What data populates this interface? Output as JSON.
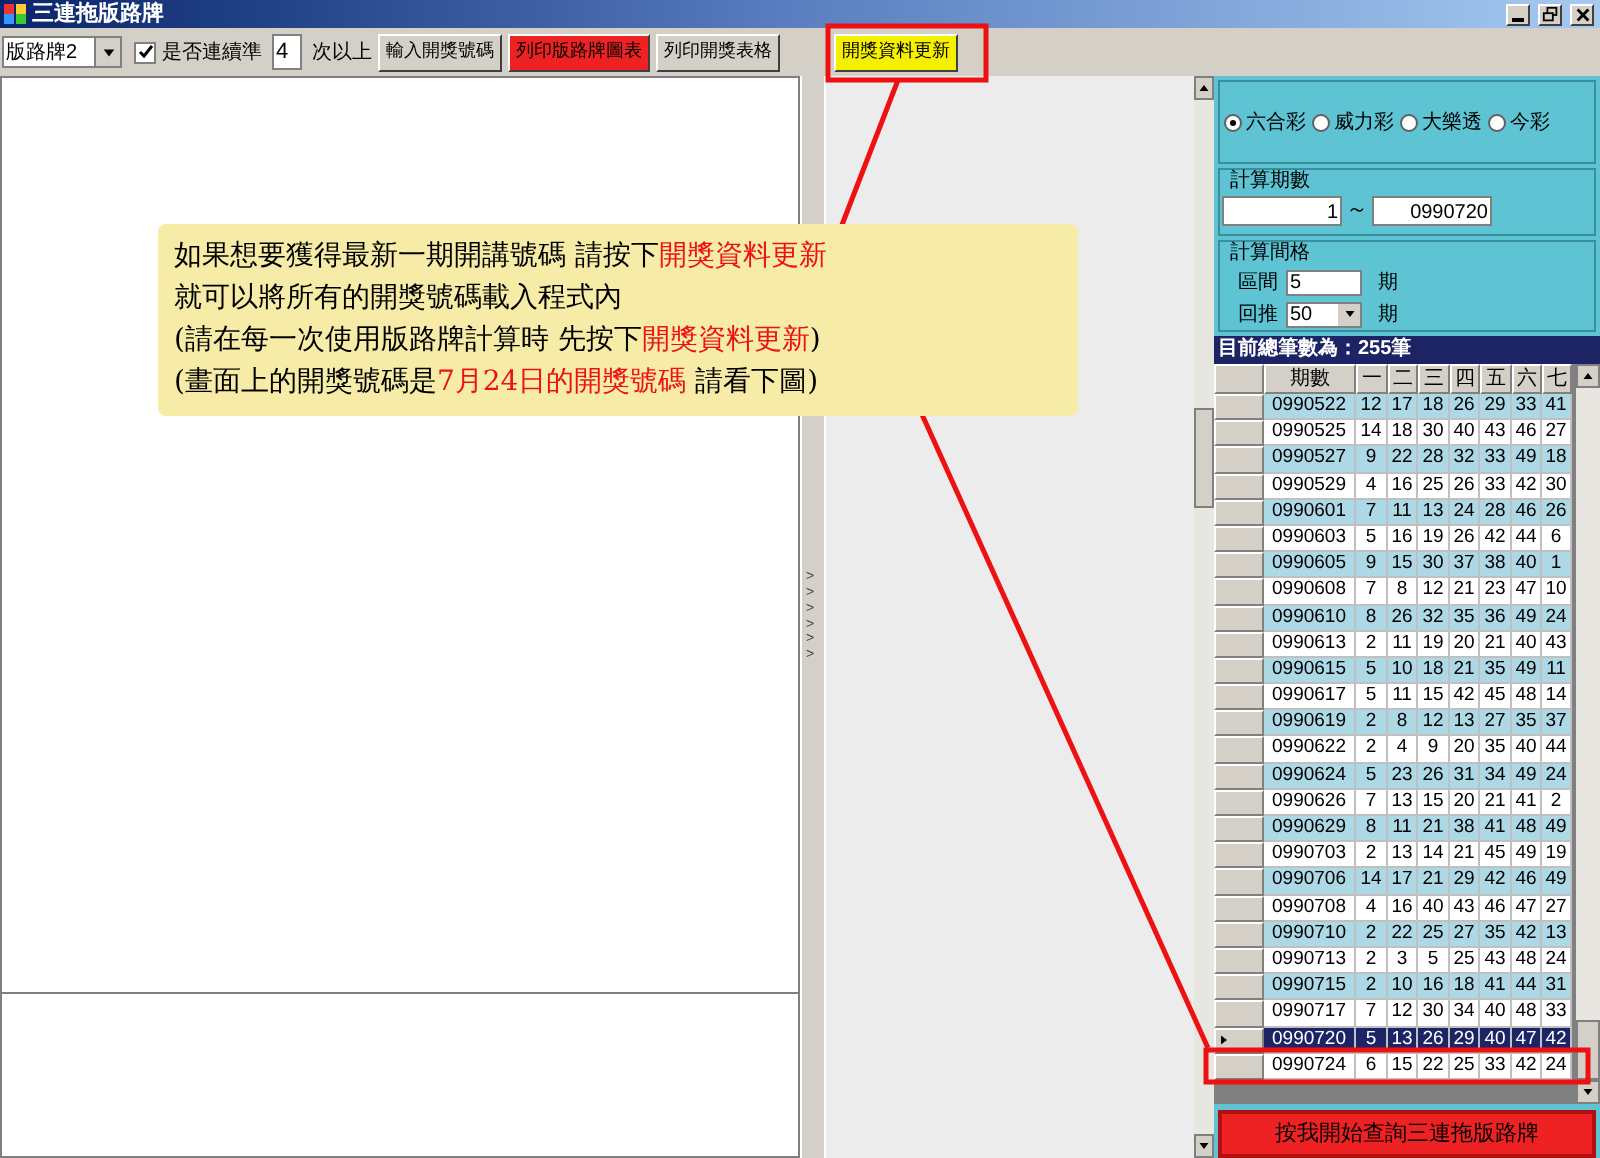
{
  "window": {
    "title": "三連拖版路牌"
  },
  "toolbar": {
    "dropdown": {
      "value": "版路牌2"
    },
    "checkbox": {
      "label": "是否連續準",
      "checked": true
    },
    "times_field": {
      "value": "4"
    },
    "times_suffix": "次以上",
    "buttons": [
      {
        "label": "輸入開獎號碼",
        "color": "#d4d0c8"
      },
      {
        "label": "列印版路牌圖表",
        "color": "#ee2222"
      },
      {
        "label": "列印開獎表格",
        "color": "#d4d0c8"
      },
      {
        "label": "開獎資料更新",
        "color": "#f4f000"
      }
    ]
  },
  "splitter": {
    "marks": ">>>>>>"
  },
  "lottery": {
    "radios": [
      {
        "label": "六合彩",
        "selected": true
      },
      {
        "label": "威力彩",
        "selected": false
      },
      {
        "label": "大樂透",
        "selected": false
      },
      {
        "label": "今彩",
        "selected": false
      }
    ],
    "period_range": {
      "title": "計算期數",
      "from": "1",
      "separator": "～",
      "to": "0990720"
    },
    "interval": {
      "title": "計算間格",
      "rows": [
        {
          "label": "區間",
          "value": "5",
          "unit": "期",
          "kind": "field"
        },
        {
          "label": "回推",
          "value": "50",
          "unit": "期",
          "kind": "dropdown"
        }
      ]
    }
  },
  "grid": {
    "caption": "目前總筆數為：255筆",
    "columns": [
      "期數",
      "一",
      "二",
      "三",
      "四",
      "五",
      "六",
      "七"
    ],
    "rows": [
      {
        "period": "0990522",
        "numbers": [
          "12",
          "17",
          "18",
          "26",
          "29",
          "33",
          "41"
        ],
        "selected": false
      },
      {
        "period": "0990525",
        "numbers": [
          "14",
          "18",
          "30",
          "40",
          "43",
          "46",
          "27"
        ],
        "selected": false
      },
      {
        "period": "0990527",
        "numbers": [
          "9",
          "22",
          "28",
          "32",
          "33",
          "49",
          "18"
        ],
        "selected": false
      },
      {
        "period": "0990529",
        "numbers": [
          "4",
          "16",
          "25",
          "26",
          "33",
          "42",
          "30"
        ],
        "selected": false
      },
      {
        "period": "0990601",
        "numbers": [
          "7",
          "11",
          "13",
          "24",
          "28",
          "46",
          "26"
        ],
        "selected": false
      },
      {
        "period": "0990603",
        "numbers": [
          "5",
          "16",
          "19",
          "26",
          "42",
          "44",
          "6"
        ],
        "selected": false
      },
      {
        "period": "0990605",
        "numbers": [
          "9",
          "15",
          "30",
          "37",
          "38",
          "40",
          "1"
        ],
        "selected": false
      },
      {
        "period": "0990608",
        "numbers": [
          "7",
          "8",
          "12",
          "21",
          "23",
          "47",
          "10"
        ],
        "selected": false
      },
      {
        "period": "0990610",
        "numbers": [
          "8",
          "26",
          "32",
          "35",
          "36",
          "49",
          "24"
        ],
        "selected": false
      },
      {
        "period": "0990613",
        "numbers": [
          "2",
          "11",
          "19",
          "20",
          "21",
          "40",
          "43"
        ],
        "selected": false
      },
      {
        "period": "0990615",
        "numbers": [
          "5",
          "10",
          "18",
          "21",
          "35",
          "49",
          "11"
        ],
        "selected": false
      },
      {
        "period": "0990617",
        "numbers": [
          "5",
          "11",
          "15",
          "42",
          "45",
          "48",
          "14"
        ],
        "selected": false
      },
      {
        "period": "0990619",
        "numbers": [
          "2",
          "8",
          "12",
          "13",
          "27",
          "35",
          "37"
        ],
        "selected": false
      },
      {
        "period": "0990622",
        "numbers": [
          "2",
          "4",
          "9",
          "20",
          "35",
          "40",
          "44"
        ],
        "selected": false
      },
      {
        "period": "0990624",
        "numbers": [
          "5",
          "23",
          "26",
          "31",
          "34",
          "49",
          "24"
        ],
        "selected": false
      },
      {
        "period": "0990626",
        "numbers": [
          "7",
          "13",
          "15",
          "20",
          "21",
          "41",
          "2"
        ],
        "selected": false
      },
      {
        "period": "0990629",
        "numbers": [
          "8",
          "11",
          "21",
          "38",
          "41",
          "48",
          "49"
        ],
        "selected": false
      },
      {
        "period": "0990703",
        "numbers": [
          "2",
          "13",
          "14",
          "21",
          "45",
          "49",
          "19"
        ],
        "selected": false
      },
      {
        "period": "0990706",
        "numbers": [
          "14",
          "17",
          "21",
          "29",
          "42",
          "46",
          "49"
        ],
        "selected": false
      },
      {
        "period": "0990708",
        "numbers": [
          "4",
          "16",
          "40",
          "43",
          "46",
          "47",
          "27"
        ],
        "selected": false
      },
      {
        "period": "0990710",
        "numbers": [
          "2",
          "22",
          "25",
          "27",
          "35",
          "42",
          "13"
        ],
        "selected": false
      },
      {
        "period": "0990713",
        "numbers": [
          "2",
          "3",
          "5",
          "25",
          "43",
          "48",
          "24"
        ],
        "selected": false
      },
      {
        "period": "0990715",
        "numbers": [
          "2",
          "10",
          "16",
          "18",
          "41",
          "44",
          "31"
        ],
        "selected": false
      },
      {
        "period": "0990717",
        "numbers": [
          "7",
          "12",
          "30",
          "34",
          "40",
          "48",
          "33"
        ],
        "selected": false
      },
      {
        "period": "0990720",
        "numbers": [
          "5",
          "13",
          "26",
          "29",
          "40",
          "47",
          "42"
        ],
        "selected": true
      },
      {
        "period": "0990724",
        "numbers": [
          "6",
          "15",
          "22",
          "25",
          "33",
          "42",
          "24"
        ],
        "selected": false
      }
    ]
  },
  "query_button": {
    "label": "按我開始查詢三連拖版路牌"
  },
  "annotation": {
    "lines": [
      [
        {
          "text": "如果想要獲得最新一期開講號碼 請按下",
          "highlight": false
        },
        {
          "text": "開獎資料更新",
          "highlight": true
        }
      ],
      [
        {
          "text": "就可以將所有的開獎號碼載入程式內",
          "highlight": false
        }
      ],
      [
        {
          "text": "(請在每一次使用版路牌計算時 先按下",
          "highlight": false
        },
        {
          "text": "開獎資料更新",
          "highlight": true
        },
        {
          "text": ")",
          "highlight": false
        }
      ],
      [
        {
          "text": "(畫面上的開獎號碼是",
          "highlight": false
        },
        {
          "text": "7月24日的開獎號碼",
          "highlight": true
        },
        {
          "text": " 請看下圖)",
          "highlight": false
        }
      ]
    ]
  }
}
